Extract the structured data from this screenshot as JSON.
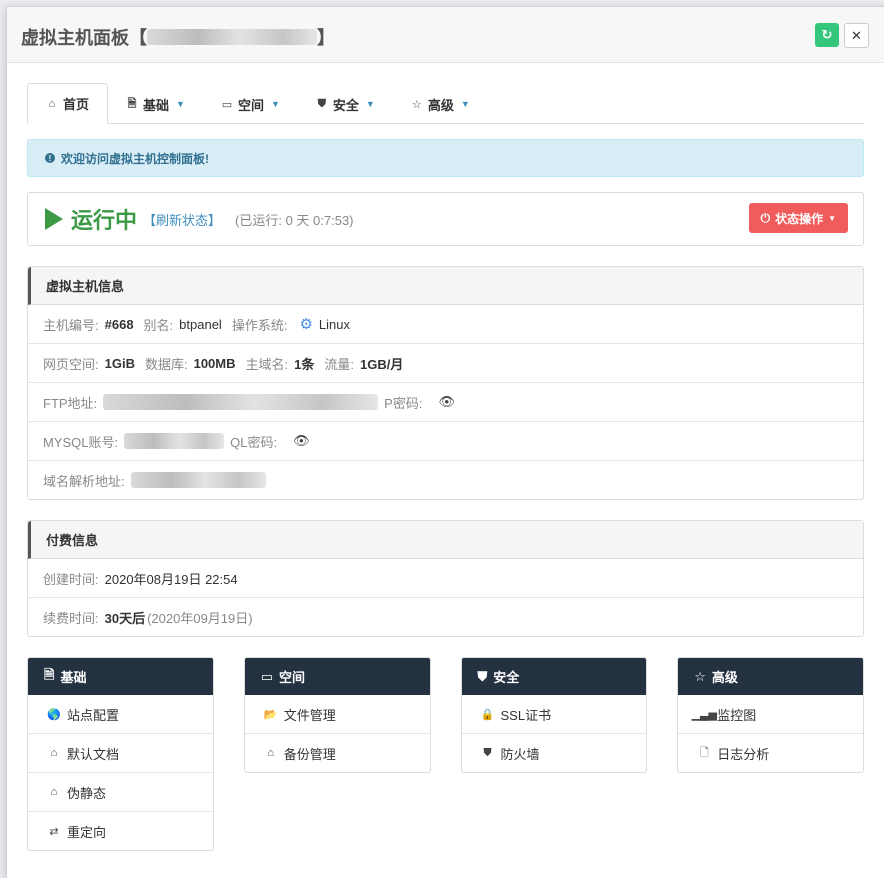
{
  "header": {
    "title_prefix": "虚拟主机面板【",
    "title_suffix": "】"
  },
  "tabs": [
    {
      "label": "首页",
      "icon": "home-icon"
    },
    {
      "label": "基础",
      "icon": "document-icon"
    },
    {
      "label": "空间",
      "icon": "drive-icon"
    },
    {
      "label": "安全",
      "icon": "shield-icon"
    },
    {
      "label": "高级",
      "icon": "star-icon"
    }
  ],
  "alert": {
    "text": "欢迎访问虚拟主机控制面板!"
  },
  "status": {
    "state": "运行中",
    "refresh": "【刷新状态】",
    "uptime": "(已运行: 0 天 0:7:53)",
    "action_button": "状态操作"
  },
  "host_info": {
    "title": "虚拟主机信息",
    "host_id_label": "主机编号:",
    "host_id": "#668",
    "alias_label": "别名:",
    "alias": "btpanel",
    "os_label": "操作系统:",
    "os": "Linux",
    "web_space_label": "网页空间:",
    "web_space": "1GiB",
    "db_label": "数据库:",
    "db": "100MB",
    "domain_label": "主域名:",
    "domain": "1条",
    "traffic_label": "流量:",
    "traffic": "1GB/月",
    "ftp_label": "FTP地址:",
    "ftp_pwd_label": "P密码:",
    "mysql_label": "MYSQL账号:",
    "mysql_pwd_label": "QL密码:",
    "dns_label": "域名解析地址:"
  },
  "billing": {
    "title": "付费信息",
    "created_label": "创建时间:",
    "created": "2020年08月19日 22:54",
    "renew_label": "续费时间:",
    "renew": "30天后",
    "renew_date": "(2020年09月19日)"
  },
  "cards": {
    "basic": {
      "title": "基础",
      "items": [
        "站点配置",
        "默认文档",
        "伪静态",
        "重定向"
      ]
    },
    "space": {
      "title": "空间",
      "items": [
        "文件管理",
        "备份管理"
      ]
    },
    "security": {
      "title": "安全",
      "items": [
        "SSL证书",
        "防火墙"
      ]
    },
    "advanced": {
      "title": "高级",
      "items": [
        "监控图",
        "日志分析"
      ]
    }
  },
  "colors": {
    "success": "#3c9a46",
    "danger": "#f05c5c",
    "link": "#3c8dbc",
    "card_header": "#233140"
  }
}
